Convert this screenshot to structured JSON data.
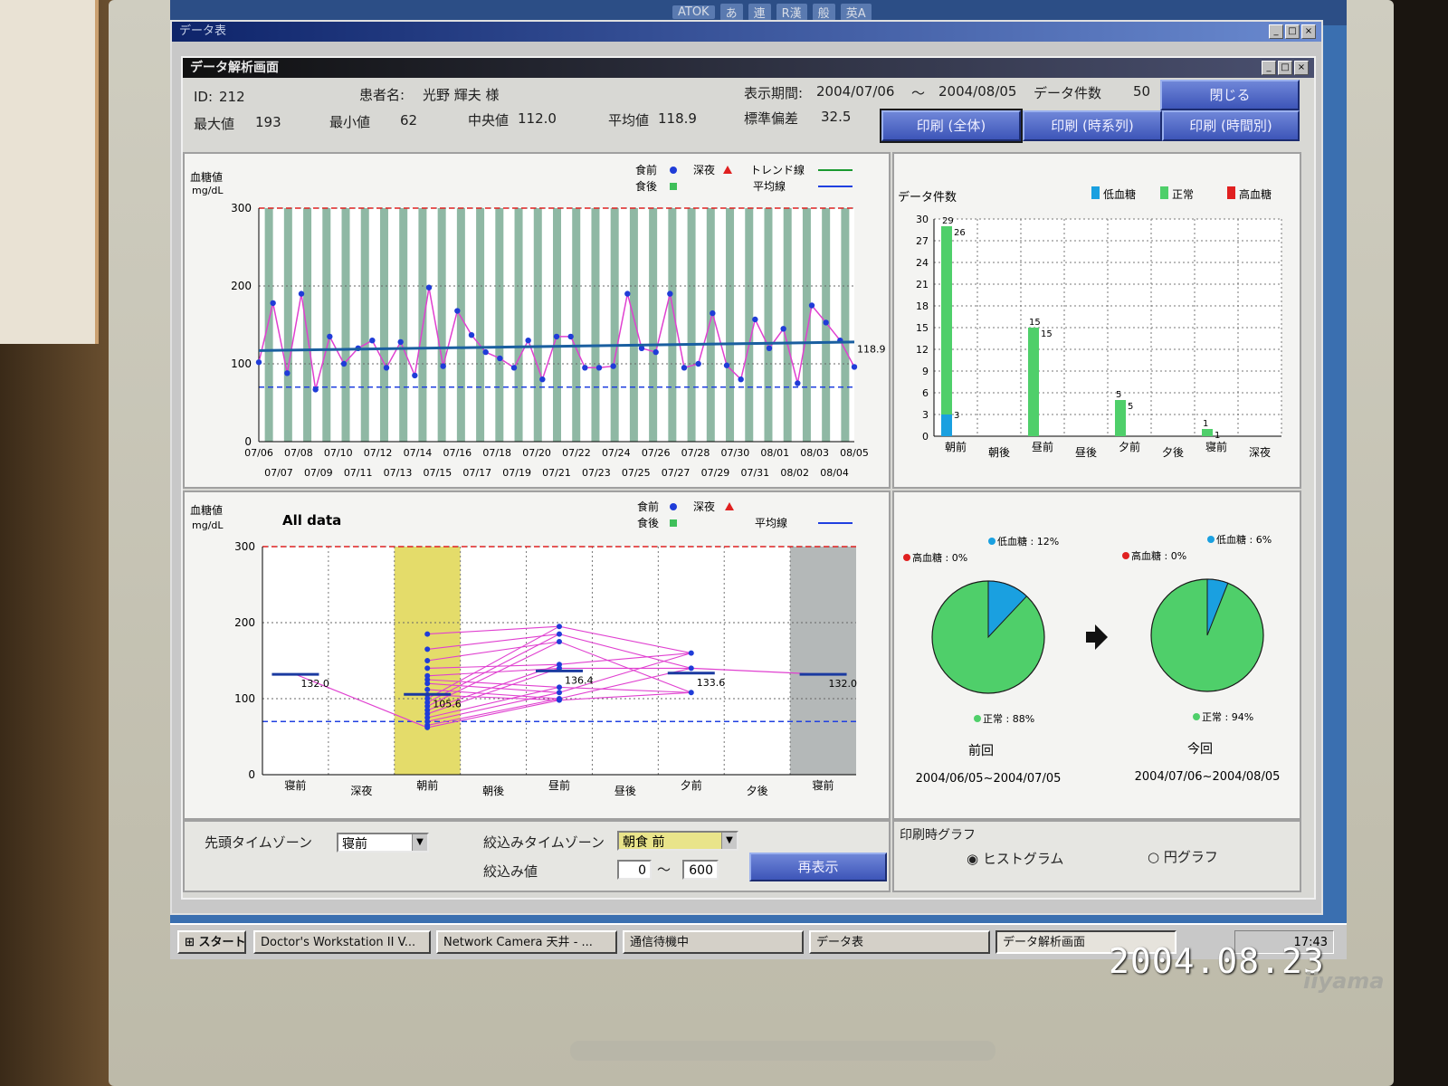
{
  "photo_timestamp": "2004.08.23",
  "monitor_brand": "iiyama",
  "ime_bar": [
    "ATOK",
    "あ",
    "連",
    "R漢",
    "般",
    "英A"
  ],
  "outer_window": {
    "title": "データ表"
  },
  "window": {
    "title": "データ解析画面"
  },
  "header": {
    "id_label": "ID:",
    "id_value": "212",
    "patient_label": "患者名:",
    "patient_value": "光野 輝夫 様",
    "period_label": "表示期間:",
    "period_from": "2004/07/06",
    "period_sep": "～",
    "period_to": "2004/08/05",
    "count_label": "データ件数",
    "count_value": "50",
    "max_label": "最大値",
    "max_value": "193",
    "min_label": "最小値",
    "min_value": "62",
    "median_label": "中央値",
    "median_value": "112.0",
    "mean_label": "平均値",
    "mean_value": "118.9",
    "sd_label": "標準偏差",
    "sd_value": "32.5"
  },
  "buttons": {
    "close": "閉じる",
    "print_all": "印刷 (全体)",
    "print_series": "印刷 (時系列)",
    "print_timezone": "印刷 (時間別)",
    "redisplay": "再表示"
  },
  "colors": {
    "before_meal": "#1f3cd8",
    "after_meal": "#3fbf5a",
    "late_night": "#e02020",
    "trend": "#1a9a30",
    "mean": "#2040e0",
    "series_line": "#e040d0",
    "low": "#1aa0e0",
    "normal": "#4fcf6a",
    "high": "#e02020"
  },
  "chart_data": [
    {
      "type": "line",
      "ylabel": "血糖値",
      "yunit": "mg/dL",
      "ylim": [
        0,
        300
      ],
      "yticks": [
        0,
        100,
        200,
        300
      ],
      "x_ticks_top": [
        "07/06",
        "07/08",
        "07/10",
        "07/12",
        "07/14",
        "07/16",
        "07/18",
        "07/20",
        "07/22",
        "07/24",
        "07/26",
        "07/28",
        "07/30",
        "08/01",
        "08/03",
        "08/05"
      ],
      "x_ticks_bottom": [
        "07/07",
        "07/09",
        "07/11",
        "07/13",
        "07/15",
        "07/17",
        "07/19",
        "07/21",
        "07/23",
        "07/25",
        "07/27",
        "07/29",
        "07/31",
        "08/02",
        "08/04"
      ],
      "legend": [
        {
          "label": "食前",
          "marker": "circle"
        },
        {
          "label": "食後",
          "marker": "square"
        },
        {
          "label": "深夜",
          "marker": "triangle"
        },
        {
          "label": "トレンド線",
          "marker": "line"
        },
        {
          "label": "平均線",
          "marker": "line"
        }
      ],
      "mean_label": "118.9",
      "mean_value": 118.9,
      "upper_limit": 300,
      "lower_limit": 70,
      "series": [
        {
          "values": [
            102,
            178,
            88,
            190,
            67,
            135,
            100,
            120,
            130,
            95,
            128,
            85,
            198,
            97,
            168,
            137,
            115,
            107,
            95,
            130,
            80,
            135,
            135,
            95,
            95,
            97,
            190,
            120,
            115,
            190,
            95,
            100,
            165,
            98,
            80,
            157,
            120,
            145,
            75,
            175,
            153,
            130,
            96
          ]
        }
      ],
      "trend": [
        117,
        128
      ]
    },
    {
      "type": "bar",
      "title": "データ件数",
      "categories": [
        "朝前",
        "朝後",
        "昼前",
        "昼後",
        "夕前",
        "夕後",
        "寝前",
        "深夜"
      ],
      "ylim": [
        0,
        30
      ],
      "yticks": [
        0,
        3,
        6,
        9,
        12,
        15,
        18,
        21,
        24,
        27,
        30
      ],
      "legend": [
        "低血糖",
        "正常",
        "高血糖"
      ],
      "series": [
        {
          "name": "低血糖",
          "values": [
            3,
            0,
            0,
            0,
            0,
            0,
            0,
            0
          ]
        },
        {
          "name": "正常",
          "values": [
            26,
            0,
            15,
            0,
            5,
            0,
            1,
            0
          ]
        },
        {
          "name": "高血糖",
          "values": [
            0,
            0,
            0,
            0,
            0,
            0,
            0,
            0
          ]
        }
      ],
      "totals": [
        29,
        0,
        15,
        0,
        5,
        0,
        1,
        0
      ],
      "stack_labels": [
        {
          "total": "29",
          "normal": "26",
          "low": "3"
        },
        {
          "total": "",
          "normal": "",
          "low": ""
        },
        {
          "total": "15",
          "normal": "15",
          "low": ""
        },
        {
          "total": "",
          "normal": "",
          "low": ""
        },
        {
          "total": "5",
          "normal": "5",
          "low": ""
        },
        {
          "total": "",
          "normal": "",
          "low": ""
        },
        {
          "total": "1",
          "normal": "1",
          "low": ""
        },
        {
          "total": "",
          "normal": "",
          "low": ""
        }
      ]
    },
    {
      "type": "line",
      "title": "All data",
      "ylabel": "血糖値",
      "yunit": "mg/dL",
      "ylim": [
        0,
        300
      ],
      "yticks": [
        0,
        100,
        200,
        300
      ],
      "categories": [
        "寝前",
        "深夜",
        "朝前",
        "朝後",
        "昼前",
        "昼後",
        "夕前",
        "夕後",
        "寝前"
      ],
      "legend": [
        {
          "label": "食前",
          "marker": "circle"
        },
        {
          "label": "食後",
          "marker": "square"
        },
        {
          "label": "深夜",
          "marker": "triangle"
        },
        {
          "label": "平均線",
          "marker": "line"
        }
      ],
      "highlight_category": "朝前",
      "means": [
        {
          "category_index": 0,
          "value": 132.0,
          "label": "132.0"
        },
        {
          "category_index": 2,
          "value": 105.6,
          "label": "105.6"
        },
        {
          "category_index": 4,
          "value": 136.4,
          "label": "136.4"
        },
        {
          "category_index": 6,
          "value": 133.6,
          "label": "133.6"
        },
        {
          "category_index": 8,
          "value": 132.0,
          "label": "132.0"
        }
      ],
      "points_asa_mae": [
        185,
        165,
        150,
        140,
        130,
        125,
        120,
        112,
        105,
        100,
        95,
        90,
        85,
        80,
        75,
        70,
        65,
        62
      ],
      "points_hiru_mae": [
        195,
        185,
        175,
        145,
        140,
        115,
        108,
        100,
        98
      ],
      "points_yu_mae": [
        160,
        140,
        108
      ],
      "mean_line_value": 70,
      "upper_limit": 300
    },
    {
      "type": "pie",
      "title": "前回",
      "period": "2004/06/05~2004/07/05",
      "slices": [
        {
          "label": "低血糖",
          "value": 12,
          "text": "低血糖 : 12%"
        },
        {
          "label": "正常",
          "value": 88,
          "text": "正常 : 88%"
        },
        {
          "label": "高血糖",
          "value": 0,
          "text": "高血糖 : 0%"
        }
      ]
    },
    {
      "type": "pie",
      "title": "今回",
      "period": "2004/07/06~2004/08/05",
      "slices": [
        {
          "label": "低血糖",
          "value": 6,
          "text": "低血糖 : 6%"
        },
        {
          "label": "正常",
          "value": 94,
          "text": "正常 : 94%"
        },
        {
          "label": "高血糖",
          "value": 0,
          "text": "高血糖 : 0%"
        }
      ]
    }
  ],
  "controls": {
    "lead_tz_label": "先頭タイムゾーン",
    "lead_tz_value": "寝前",
    "filter_tz_label": "絞込みタイムゾーン",
    "filter_tz_value": "朝食 前",
    "filter_value_label": "絞込み値",
    "filter_min": "0",
    "filter_sep": "～",
    "filter_max": "600"
  },
  "print_graph": {
    "legend": "印刷時グラフ",
    "option_histogram": "ヒストグラム",
    "option_pie": "円グラフ",
    "selected": "ヒストグラム"
  },
  "taskbar": {
    "start": "スタート",
    "tasks": [
      "Doctor's Workstation II V...",
      "Network Camera 天井 - ...",
      "通信待機中",
      "データ表",
      "データ解析画面"
    ],
    "clock": "17:43"
  }
}
